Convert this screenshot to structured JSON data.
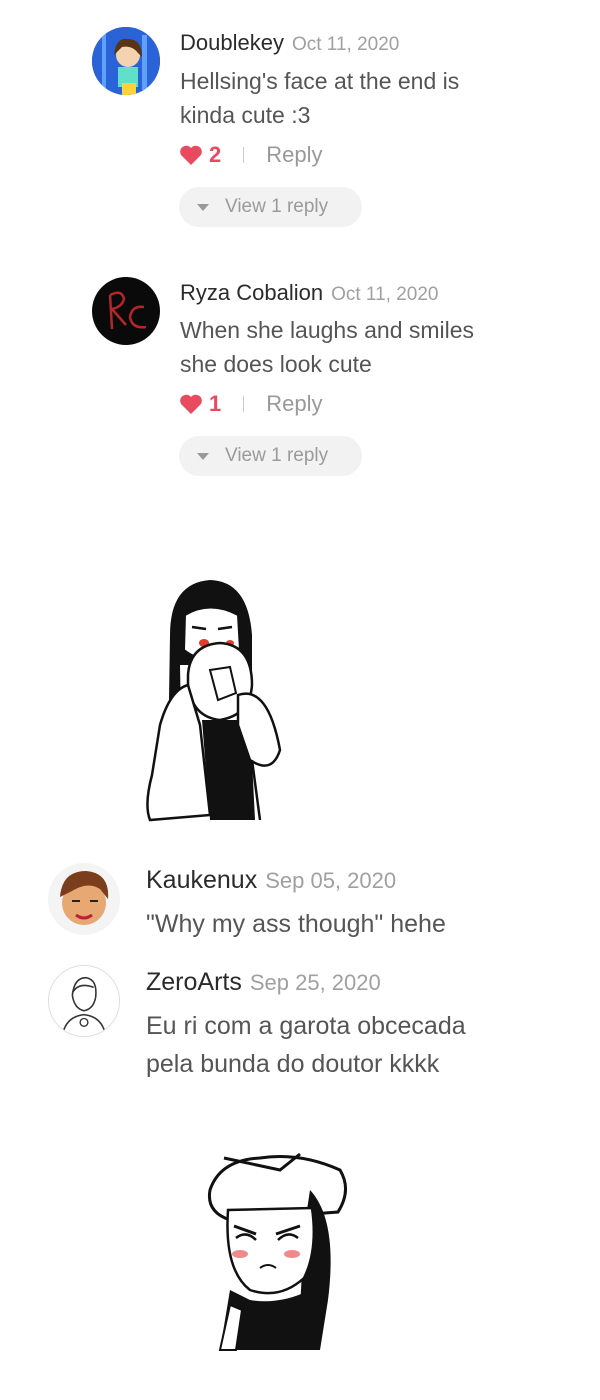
{
  "comments": [
    {
      "username": "Doublekey",
      "date": "Oct 11, 2020",
      "text": [
        "Hellsing's face at the end is",
        "kinda cute :3"
      ],
      "likes": "2",
      "reply_label": "Reply",
      "view_replies_label": "View 1 reply"
    },
    {
      "username": "Ryza Cobalion",
      "date": "Oct 11, 2020",
      "text": [
        "When she laughs and smiles",
        "she does look cute"
      ],
      "likes": "1",
      "reply_label": "Reply",
      "view_replies_label": "View 1 reply"
    },
    {
      "username": "Kaukenux",
      "date": "Sep 05, 2020",
      "text": [
        "\"Why my ass though\" hehe"
      ]
    },
    {
      "username": "ZeroArts",
      "date": "Sep 25, 2020",
      "text": [
        "Eu ri com a garota obcecada",
        "pela bunda do doutor kkkk"
      ]
    }
  ],
  "colors": {
    "heart": "#e84a5f",
    "pill_bg": "#f2f2f2"
  }
}
